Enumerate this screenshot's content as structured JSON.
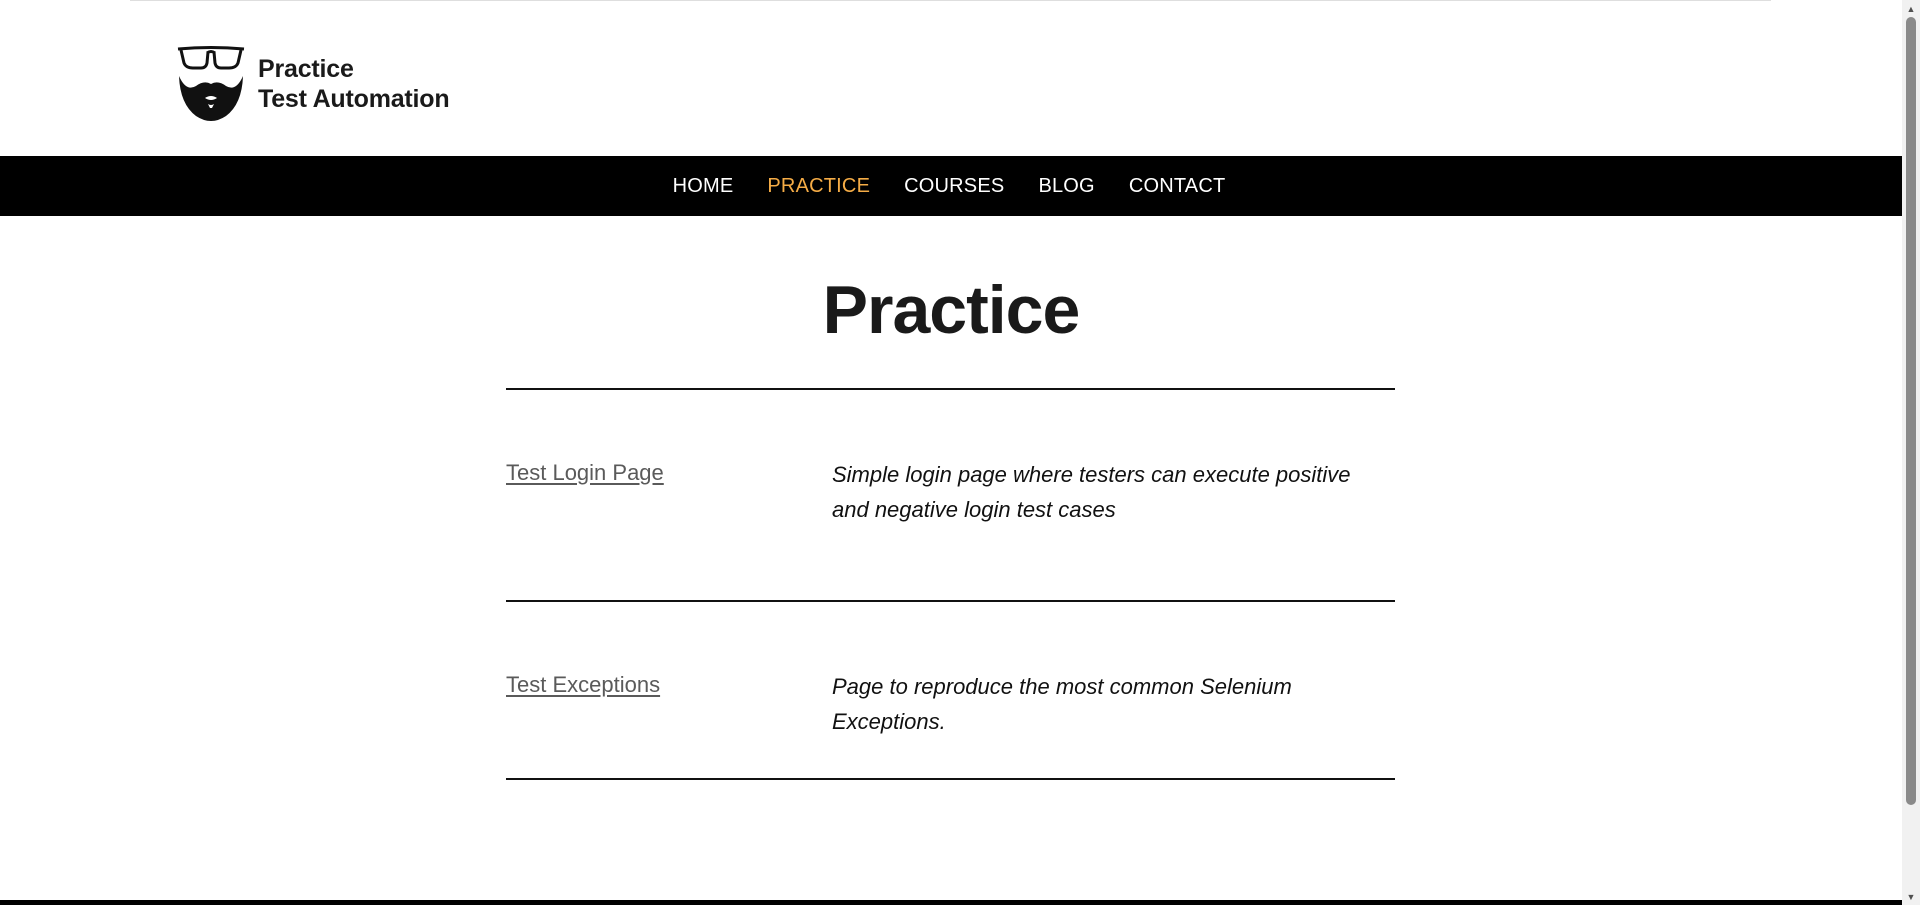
{
  "logo": {
    "line1": "Practice",
    "line2": "Test Automation",
    "icon": "bearded-face-glasses-icon"
  },
  "nav": {
    "items": [
      {
        "label": "HOME",
        "active": false
      },
      {
        "label": "PRACTICE",
        "active": true
      },
      {
        "label": "COURSES",
        "active": false
      },
      {
        "label": "BLOG",
        "active": false
      },
      {
        "label": "CONTACT",
        "active": false
      }
    ],
    "colors": {
      "background": "#000000",
      "text": "#ffffff",
      "active": "#f5ac46"
    }
  },
  "main": {
    "title": "Practice",
    "rows": [
      {
        "link": "Test Login Page",
        "description": "Simple login page where testers can execute positive and negative login test cases"
      },
      {
        "link": "Test Exceptions",
        "description": "Page to reproduce the most common Selenium Exceptions."
      }
    ]
  },
  "scrollbar": {
    "up_icon": "scroll-up-arrow-icon",
    "down_icon": "scroll-down-arrow-icon"
  }
}
